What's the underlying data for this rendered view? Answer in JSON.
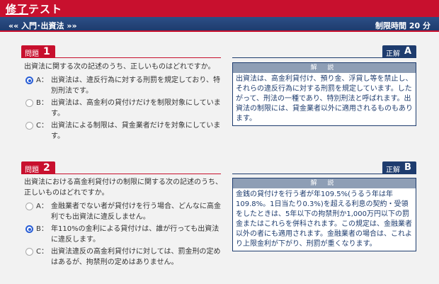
{
  "app": {
    "title_prefix": "修了",
    "title_suffix": "テスト"
  },
  "nav": {
    "breadcrumb": "«« 入門･出資法 »»",
    "time_limit": "制限時間 20 分"
  },
  "questions": [
    {
      "label": "問題",
      "number": "1",
      "text": "出資法に関する次の記述のうち、正しいものはどれですか。",
      "choices": [
        {
          "letter": "A：",
          "text": "出資法は、違反行為に対する刑罰を規定しており、特別刑法です。",
          "selected": true
        },
        {
          "letter": "B：",
          "text": "出資法は、高金利の貸付けだけを制限対象にしています。",
          "selected": false
        },
        {
          "letter": "C：",
          "text": "出資法による制限は、貸金業者だけを対象にしています。",
          "selected": false
        }
      ],
      "answer_label": "正解",
      "answer": "A",
      "explanation_title": "解 説",
      "explanation": "出資法は、高金利貸付け、預り金、浮貸し等を禁止し、それらの違反行為に対する刑罰を規定しています。したがって、刑法の一種であり、特別刑法と呼ばれます。出資法の制限には、貸金業者以外に適用されるものもあります。"
    },
    {
      "label": "問題",
      "number": "2",
      "text": "出資法における高金利貸付けの制限に関する次の記述のうち、正しいものはどれですか。",
      "choices": [
        {
          "letter": "A：",
          "text": "金融業者でない者が貸付けを行う場合、どんなに高金利でも出資法に違反しません。",
          "selected": false
        },
        {
          "letter": "B：",
          "text": "年110%の金利による貸付けは、誰が行っても出資法に違反します。",
          "selected": true
        },
        {
          "letter": "C：",
          "text": "出資法違反の高金利貸付けに対しては、罰金刑の定めはあるが、拘禁刑の定めはありません。",
          "selected": false
        }
      ],
      "answer_label": "正解",
      "answer": "B",
      "explanation_title": "解 説",
      "explanation": "金銭の貸付けを行う者が年109.5%(うるう年は年109.8%。1日当たり0.3%)を超える利息の契約・受領をしたときは、5年以下の拘禁刑か1,000万円以下の罰金またはこれらを併科されます。この規定は、金融業者以外の者にも適用されます。金融業者の場合は、これより上限金利が下がり、刑罰が重くなります。"
    }
  ],
  "colors": {
    "brand_red": "#c8102e",
    "navy": "#1e3c6e",
    "radio_blue": "#2a5fd6"
  }
}
